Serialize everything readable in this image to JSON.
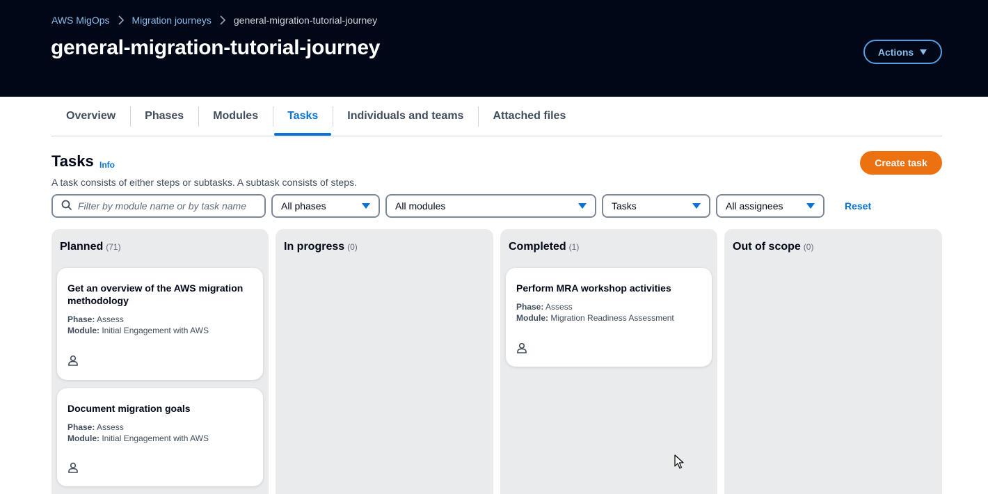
{
  "breadcrumb": {
    "items": [
      "AWS MigOps",
      "Migration journeys"
    ],
    "current": "general-migration-tutorial-journey"
  },
  "page": {
    "title": "general-migration-tutorial-journey",
    "actions_label": "Actions"
  },
  "tabs": [
    {
      "label": "Overview",
      "active": false
    },
    {
      "label": "Phases",
      "active": false
    },
    {
      "label": "Modules",
      "active": false
    },
    {
      "label": "Tasks",
      "active": true
    },
    {
      "label": "Individuals and teams",
      "active": false
    },
    {
      "label": "Attached files",
      "active": false
    }
  ],
  "tasks_section": {
    "title": "Tasks",
    "info_label": "Info",
    "description": "A task consists of either steps or subtasks. A subtask consists of steps.",
    "create_label": "Create task"
  },
  "filters": {
    "search_placeholder": "Filter by module name or by task name",
    "phase": "All phases",
    "module": "All modules",
    "type": "Tasks",
    "assignee": "All assignees",
    "reset_label": "Reset"
  },
  "columns": [
    {
      "name": "Planned",
      "count": "(71)",
      "cards": [
        {
          "title": "Get an overview of the AWS migration methodology",
          "phase_label": "Phase:",
          "phase": "Assess",
          "module_label": "Module:",
          "module": "Initial Engagement with AWS"
        },
        {
          "title": "Document migration goals",
          "phase_label": "Phase:",
          "phase": "Assess",
          "module_label": "Module:",
          "module": "Initial Engagement with AWS"
        }
      ]
    },
    {
      "name": "In progress",
      "count": "(0)",
      "cards": []
    },
    {
      "name": "Completed",
      "count": "(1)",
      "cards": [
        {
          "title": "Perform MRA workshop activities",
          "phase_label": "Phase:",
          "phase": "Assess",
          "module_label": "Module:",
          "module": "Migration Readiness Assessment"
        }
      ]
    },
    {
      "name": "Out of scope",
      "count": "(0)",
      "cards": []
    }
  ],
  "colors": {
    "header_bg": "#000716",
    "link_blue": "#0972d3",
    "accent_orange": "#ec7211",
    "column_bg": "#e9ebed"
  }
}
